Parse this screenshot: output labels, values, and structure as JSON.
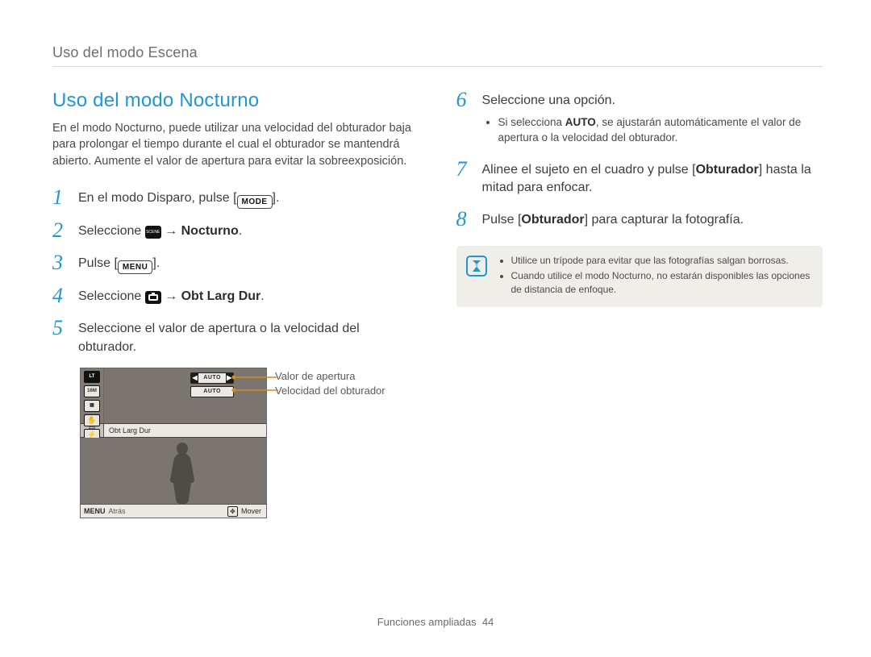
{
  "breadcrumb": "Uso del modo Escena",
  "section_title": "Uso del modo Nocturno",
  "intro": "En el modo Nocturno, puede utilizar una velocidad del obturador baja para prolongar el tiempo durante el cual el obturador se mantendrá abierto. Aumente el valor de apertura para evitar la sobreexposición.",
  "steps_left": [
    {
      "n": "1",
      "pre": "En el modo Disparo, pulse [",
      "badge_kind": "mode",
      "badge_text": "MODE",
      "post": "]."
    },
    {
      "n": "2",
      "pre": "Seleccione ",
      "badge_kind": "scene",
      "mid": " → ",
      "bold": "Nocturno",
      "post": "."
    },
    {
      "n": "3",
      "pre": "Pulse [",
      "badge_kind": "menu",
      "badge_text": "MENU",
      "post": "]."
    },
    {
      "n": "4",
      "pre": "Seleccione ",
      "badge_kind": "cam",
      "mid": " → ",
      "bold": "Obt Larg Dur",
      "post": "."
    },
    {
      "n": "5",
      "text": "Seleccione el valor de apertura o la velocidad del obturador."
    }
  ],
  "camera_screen": {
    "top_badge": "LT",
    "left_icons": [
      "16M",
      "grid",
      "hand",
      "flash"
    ],
    "auto_label": "AUTO",
    "selected_row": "Obt Larg Dur",
    "footer_menu": "MENU",
    "footer_back": "Atrás",
    "footer_move": "Mover"
  },
  "screen_legend": {
    "aperture": "Valor de apertura",
    "shutter": "Velocidad del obturador"
  },
  "steps_right": [
    {
      "n": "6",
      "text": "Seleccione una opción.",
      "sub": [
        "Si selecciona AUTO, se ajustarán automáticamente el valor de apertura o la velocidad del obturador."
      ],
      "sub_bold": "AUTO"
    },
    {
      "n": "7",
      "pre": "Alinee el sujeto en el cuadro y pulse [",
      "bold": "Obturador",
      "post": "] hasta la mitad para enfocar."
    },
    {
      "n": "8",
      "pre": "Pulse [",
      "bold": "Obturador",
      "post": "] para capturar la fotografía."
    }
  ],
  "note_items": [
    "Utilice un trípode para evitar que las fotografías salgan borrosas.",
    "Cuando utilice el modo Nocturno, no estarán disponibles las opciones de distancia de enfoque."
  ],
  "footer_section": "Funciones ampliadas",
  "footer_page": "44"
}
